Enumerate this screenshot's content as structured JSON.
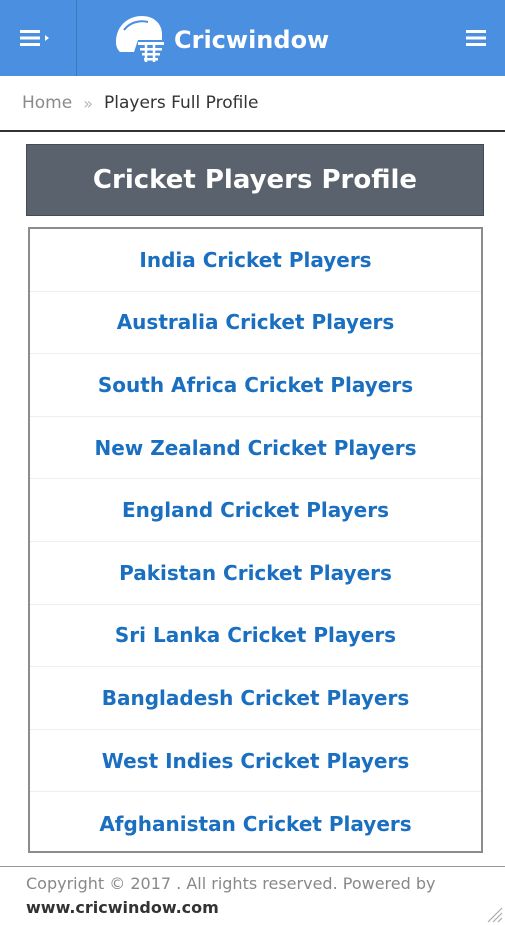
{
  "header": {
    "brand": "Cricwindow",
    "left_menu_icon": "hamburger-dropdown-icon",
    "right_menu_icon": "hamburger-icon",
    "logo_icon": "cricket-helmet-icon",
    "bg_color": "#4a8fe0"
  },
  "breadcrumb": {
    "home": "Home",
    "separator": "»",
    "current": "Players Full Profile"
  },
  "section": {
    "title": "Cricket Players Profile"
  },
  "players_links": [
    "India Cricket Players",
    "Australia Cricket Players",
    "South Africa Cricket Players",
    "New Zealand Cricket Players",
    "England Cricket Players",
    "Pakistan Cricket Players",
    "Sri Lanka Cricket Players",
    "Bangladesh Cricket Players",
    "West Indies Cricket Players",
    "Afghanistan Cricket Players"
  ],
  "footer": {
    "copyright": "Copyright © 2017 . All rights reserved. Powered by",
    "site": "www.cricwindow.com"
  },
  "colors": {
    "link": "#1a6fc0",
    "heading_bg": "#5a626d"
  }
}
